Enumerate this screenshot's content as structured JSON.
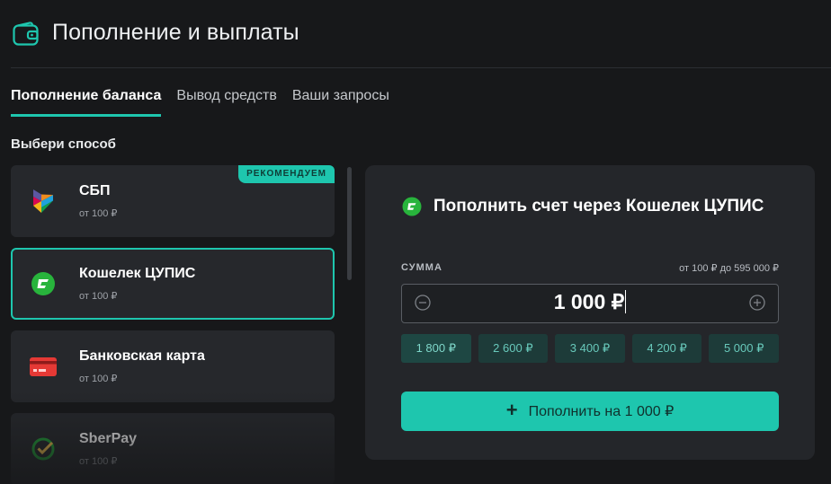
{
  "header": {
    "title": "Пополнение и выплаты",
    "icon": "wallet-icon"
  },
  "tabs": [
    {
      "label": "Пополнение баланса",
      "active": true
    },
    {
      "label": "Вывод средств",
      "active": false
    },
    {
      "label": "Ваши запросы",
      "active": false
    }
  ],
  "methods_section": {
    "title": "Выбери способ",
    "items": [
      {
        "name": "СБП",
        "min": "от 100 ₽",
        "icon": "sbp-logo-icon",
        "badge": "РЕКОМЕНДУЕМ"
      },
      {
        "name": "Кошелек ЦУПИС",
        "min": "от 100 ₽",
        "icon": "cupis-logo-icon",
        "selected": true
      },
      {
        "name": "Банковская карта",
        "min": "от 100 ₽",
        "icon": "bank-card-icon"
      },
      {
        "name": "SberPay",
        "min": "от 100 ₽",
        "icon": "sberpay-logo-icon"
      }
    ]
  },
  "panel": {
    "title": "Пополнить счет через Кошелек ЦУПИС",
    "amount_label": "СУММА",
    "range_hint": "от 100 ₽ до 595 000 ₽",
    "amount_value": "1 000 ₽",
    "presets": [
      "1 800 ₽",
      "2 600 ₽",
      "3 400 ₽",
      "4 200 ₽",
      "5 000 ₽"
    ],
    "submit_label": "Пополнить на 1 000 ₽"
  },
  "colors": {
    "accent": "#1ec6ae",
    "background": "#17181a",
    "card": "#26282c",
    "panel": "#24262a"
  }
}
